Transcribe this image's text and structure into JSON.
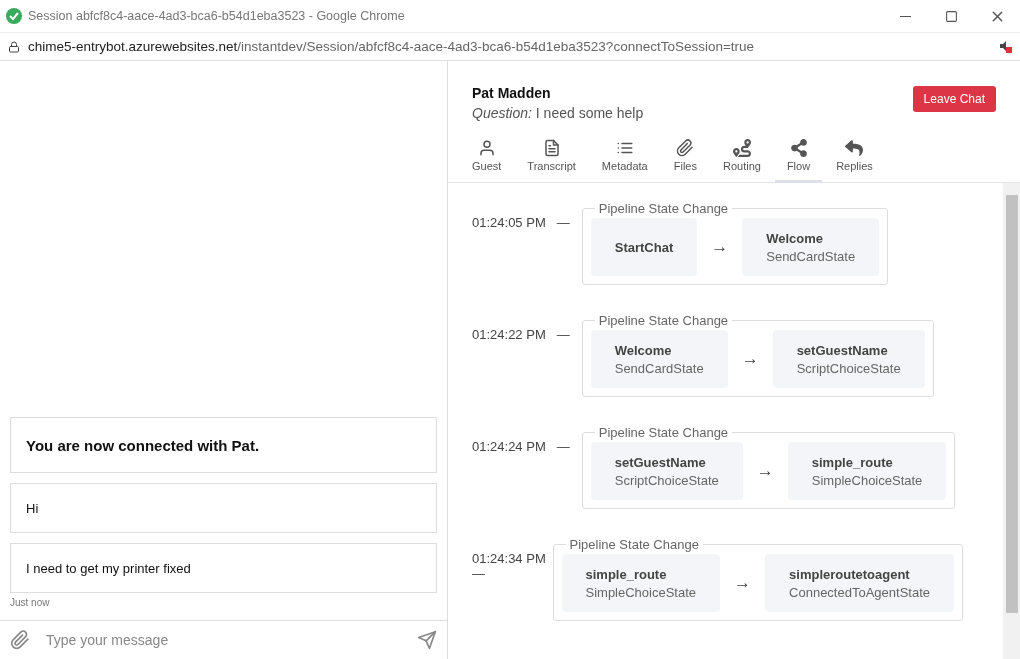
{
  "window": {
    "title": "Session abfcf8c4-aace-4ad3-bca6-b54d1eba3523 - Google Chrome"
  },
  "address_bar": {
    "host": "chime5-entrybot.azurewebsites.net",
    "path": "/instantdev/Session/abfcf8c4-aace-4ad3-bca6-b54d1eba3523?connectToSession=true"
  },
  "chat": {
    "messages": [
      {
        "text": "You are now connected with Pat.",
        "kind": "notice"
      },
      {
        "text": "Hi",
        "kind": "message"
      },
      {
        "text": "I need to get my printer fixed",
        "kind": "message"
      }
    ],
    "timestamp": "Just now",
    "composer": {
      "placeholder": "Type your message"
    }
  },
  "guest": {
    "name": "Pat Madden",
    "question_label": "Question:",
    "question": "I need some help"
  },
  "leave_button": "Leave Chat",
  "tabs": [
    {
      "label": "Guest",
      "selected": false
    },
    {
      "label": "Transcript",
      "selected": false
    },
    {
      "label": "Metadata",
      "selected": false
    },
    {
      "label": "Files",
      "selected": false
    },
    {
      "label": "Routing",
      "selected": false
    },
    {
      "label": "Flow",
      "selected": true
    },
    {
      "label": "Replies",
      "selected": false
    }
  ],
  "events": [
    {
      "time": "01:24:05 PM",
      "dash": "—",
      "title": "Pipeline State Change",
      "arrow": "→",
      "from": {
        "name": "StartChat"
      },
      "to": {
        "name": "Welcome",
        "type": "SendCardState"
      }
    },
    {
      "time": "01:24:22 PM",
      "dash": "—",
      "title": "Pipeline State Change",
      "arrow": "→",
      "from": {
        "name": "Welcome",
        "type": "SendCardState"
      },
      "to": {
        "name": "setGuestName",
        "type": "ScriptChoiceState"
      }
    },
    {
      "time": "01:24:24 PM",
      "dash": "—",
      "title": "Pipeline State Change",
      "arrow": "→",
      "from": {
        "name": "setGuestName",
        "type": "ScriptChoiceState"
      },
      "to": {
        "name": "simple_route",
        "type": "SimpleChoiceState"
      }
    },
    {
      "time": "01:24:34 PM",
      "dash": "—",
      "title": "Pipeline State Change",
      "arrow": "→",
      "from": {
        "name": "simple_route",
        "type": "SimpleChoiceState"
      },
      "to": {
        "name": "simpleroutetoagent",
        "type": "ConnectedToAgentState"
      }
    }
  ]
}
